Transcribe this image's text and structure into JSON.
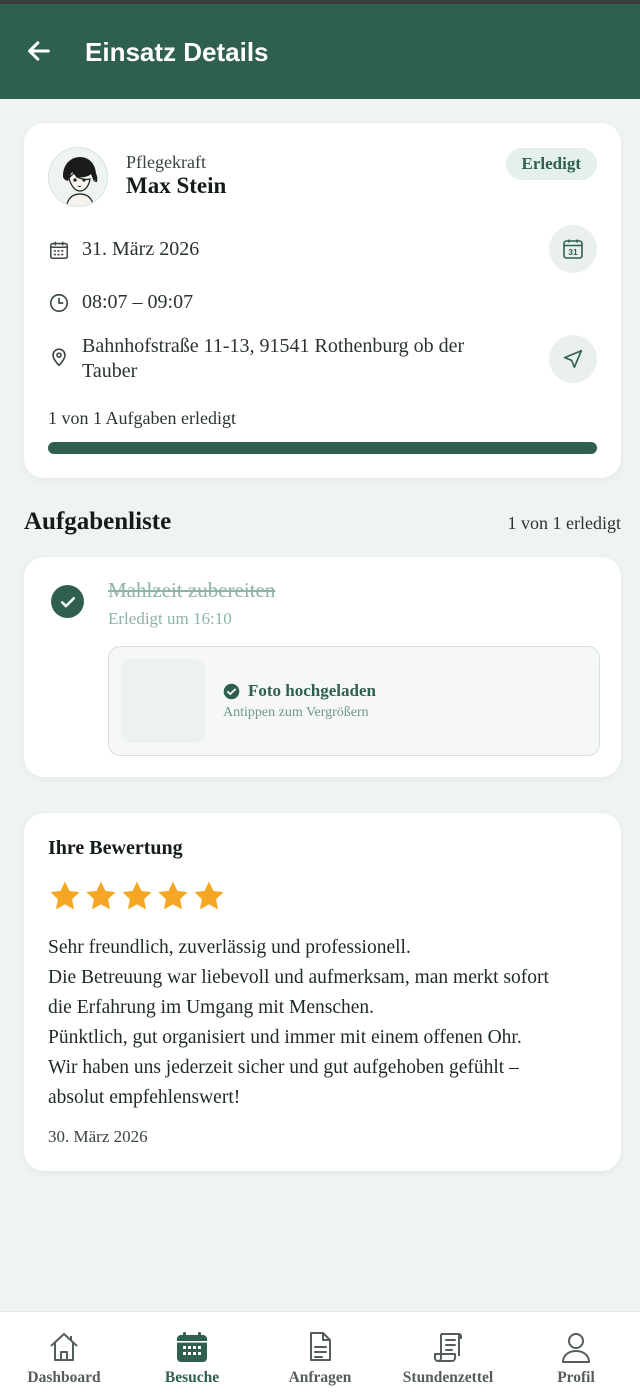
{
  "header": {
    "title": "Einsatz Details"
  },
  "visit": {
    "role_label": "Pflegekraft",
    "name": "Max Stein",
    "status": "Erledigt",
    "date": "31. März 2026",
    "calendar_icon_day": "31",
    "time": "08:07 – 09:07",
    "address": "Bahnhofstraße 11-13, 91541 Rothenburg ob der Tauber",
    "progress_text": "1 von 1 Aufgaben erledigt",
    "progress_fraction": 1.0
  },
  "tasks": {
    "title": "Aufgabenliste",
    "count": "1 von 1 erledigt",
    "items": [
      {
        "title": "Mahlzeit zubereiten",
        "done_text": "Erledigt um 16:10",
        "photo_status": "Foto hochgeladen",
        "photo_hint": "Antippen zum Vergrößern"
      }
    ]
  },
  "review": {
    "title": "Ihre Bewertung",
    "rating": 5,
    "lines": [
      "Sehr freundlich, zuverlässig und professionell.",
      "Die Betreuung war liebevoll und aufmerksam, man merkt sofort",
      "die Erfahrung im Umgang mit Menschen.",
      "Pünktlich, gut organisiert und immer mit einem offenen Ohr.",
      "Wir haben uns jederzeit sicher und gut aufgehoben gefühlt –",
      "absolut empfehlenswert!"
    ],
    "date": "30. März 2026"
  },
  "nav": {
    "items": [
      {
        "label": "Dashboard",
        "icon": "home-icon"
      },
      {
        "label": "Besuche",
        "icon": "calendar-icon"
      },
      {
        "label": "Anfragen",
        "icon": "document-icon"
      },
      {
        "label": "Stundenzettel",
        "icon": "scroll-icon"
      },
      {
        "label": "Profil",
        "icon": "user-icon"
      }
    ],
    "active_index": 1
  },
  "colors": {
    "primary": "#2f5f50",
    "background": "#eff4f3",
    "star": "#f5a623",
    "done_text": "#8fb3a5"
  }
}
